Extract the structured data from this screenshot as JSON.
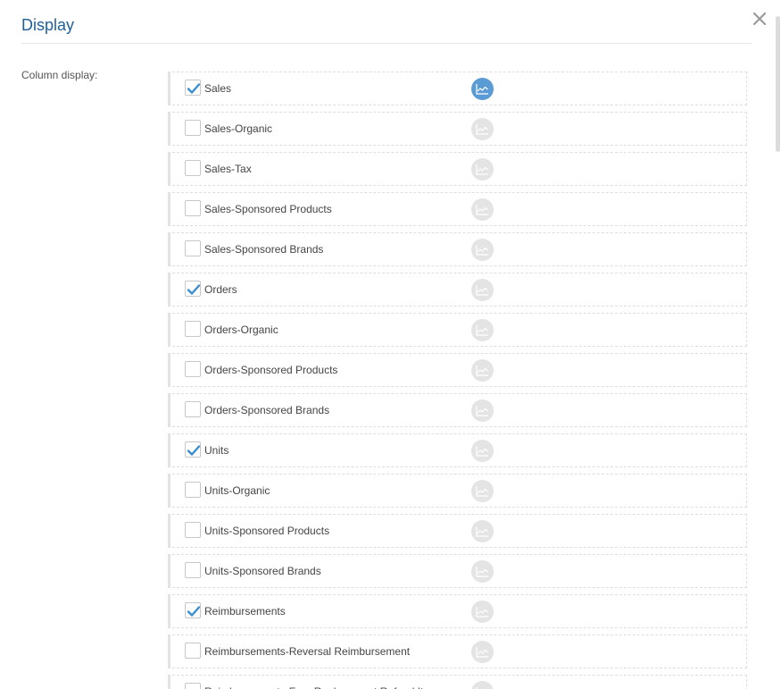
{
  "dialog": {
    "title": "Display",
    "close_icon": "close-icon"
  },
  "column_display": {
    "label": "Column display:",
    "check_icon": "checkmark-icon",
    "trend_icon": "line-chart-icon",
    "accent_color": "#5b9bd5",
    "items": [
      {
        "label": "Sales",
        "checked": true,
        "chart_active": true
      },
      {
        "label": "Sales-Organic",
        "checked": false,
        "chart_active": false
      },
      {
        "label": "Sales-Tax",
        "checked": false,
        "chart_active": false
      },
      {
        "label": "Sales-Sponsored Products",
        "checked": false,
        "chart_active": false
      },
      {
        "label": "Sales-Sponsored Brands",
        "checked": false,
        "chart_active": false
      },
      {
        "label": "Orders",
        "checked": true,
        "chart_active": false
      },
      {
        "label": "Orders-Organic",
        "checked": false,
        "chart_active": false
      },
      {
        "label": "Orders-Sponsored Products",
        "checked": false,
        "chart_active": false
      },
      {
        "label": "Orders-Sponsored Brands",
        "checked": false,
        "chart_active": false
      },
      {
        "label": "Units",
        "checked": true,
        "chart_active": false
      },
      {
        "label": "Units-Organic",
        "checked": false,
        "chart_active": false
      },
      {
        "label": "Units-Sponsored Products",
        "checked": false,
        "chart_active": false
      },
      {
        "label": "Units-Sponsored Brands",
        "checked": false,
        "chart_active": false
      },
      {
        "label": "Reimbursements",
        "checked": true,
        "chart_active": false
      },
      {
        "label": "Reimbursements-Reversal Reimbursement",
        "checked": false,
        "chart_active": false
      },
      {
        "label": "Reimbursements-Free Replacement Refund Items",
        "checked": false,
        "chart_active": false
      }
    ]
  }
}
